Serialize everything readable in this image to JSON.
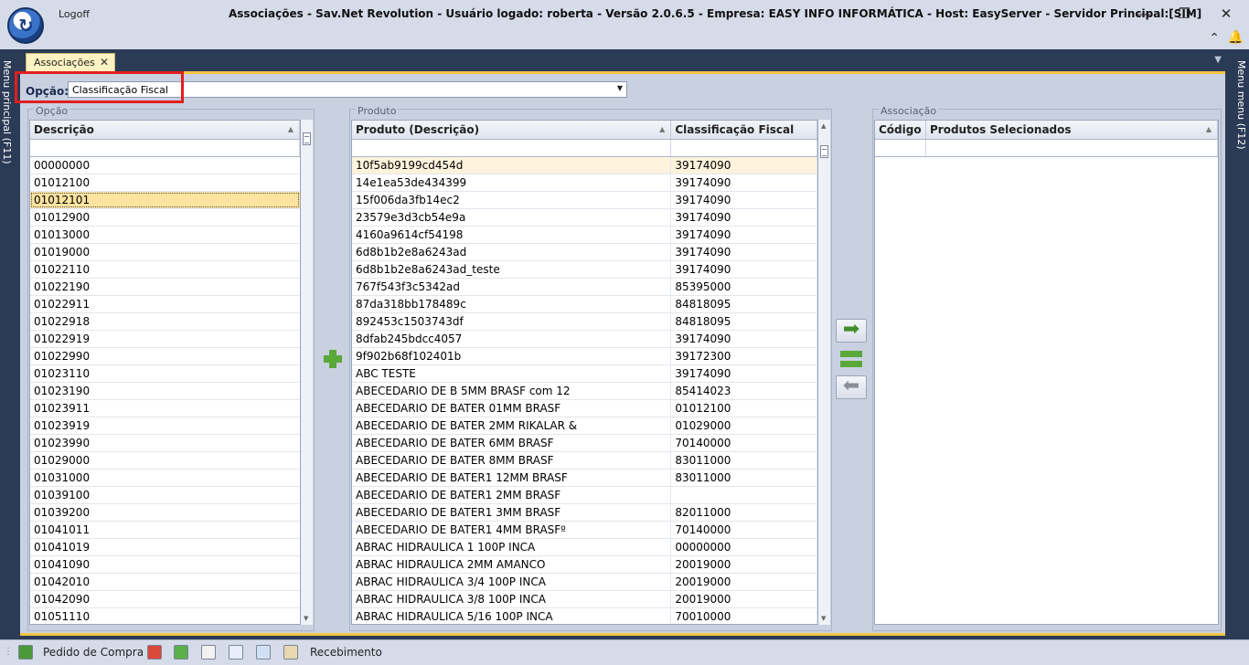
{
  "window": {
    "logoff": "Logoff",
    "title": "Associações - Sav.Net Revolution - Usuário logado: roberta - Versão 2.0.6.5 - Empresa: EASY INFO INFORMÁTICA - Host: EasyServer - Servidor Principal:[SIM]",
    "controls": {
      "minimize": "—",
      "restore": "❐",
      "close": "✕"
    }
  },
  "side_menus": {
    "left": "Menu principal (F11)",
    "right": "Menu menu (F12)"
  },
  "doc_tab": {
    "label": "Associações",
    "close": "✕"
  },
  "option": {
    "label": "Opção:",
    "value": "Classificação Fiscal"
  },
  "groups": {
    "opcao": {
      "title": "Opção",
      "column": "Descrição",
      "rows": [
        "00000000",
        "01012100",
        "01012101",
        "01012900",
        "01013000",
        "01019000",
        "01022110",
        "01022190",
        "01022911",
        "01022918",
        "01022919",
        "01022990",
        "01023110",
        "01023190",
        "01023911",
        "01023919",
        "01023990",
        "01029000",
        "01031000",
        "01039100",
        "01039200",
        "01041011",
        "01041019",
        "01041090",
        "01042010",
        "01042090",
        "01051110"
      ],
      "selected_index": 2
    },
    "produto": {
      "title": "Produto",
      "columns": [
        "Produto (Descrição)",
        "Classificação Fiscal"
      ],
      "rows": [
        [
          "10f5ab9199cd454d",
          "39174090"
        ],
        [
          "14e1ea53de434399",
          "39174090"
        ],
        [
          "15f006da3fb14ec2",
          "39174090"
        ],
        [
          "23579e3d3cb54e9a",
          "39174090"
        ],
        [
          "4160a9614cf54198",
          "39174090"
        ],
        [
          "6d8b1b2e8a6243ad",
          "39174090"
        ],
        [
          "6d8b1b2e8a6243ad_teste",
          "39174090"
        ],
        [
          "767f543f3c5342ad",
          "85395000"
        ],
        [
          "87da318bb178489c",
          "84818095"
        ],
        [
          "892453c1503743df",
          "84818095"
        ],
        [
          "8dfab245bdcc4057",
          "39174090"
        ],
        [
          "9f902b68f102401b",
          "39172300"
        ],
        [
          "ABC TESTE",
          "39174090"
        ],
        [
          "ABECEDARIO DE B 5MM BRASF com 12",
          "85414023"
        ],
        [
          "ABECEDARIO DE BATER 01MM BRASF",
          "01012100"
        ],
        [
          "ABECEDARIO DE BATER 2MM RIKALAR &",
          "01029000"
        ],
        [
          "ABECEDARIO DE BATER 6MM BRASF",
          "70140000"
        ],
        [
          "ABECEDARIO DE BATER 8MM BRASF",
          "83011000"
        ],
        [
          "ABECEDARIO DE BATER1 12MM BRASF",
          "83011000"
        ],
        [
          "ABECEDARIO DE BATER1 2MM BRASF",
          ""
        ],
        [
          "ABECEDARIO DE BATER1 3MM BRASF",
          "82011000"
        ],
        [
          "ABECEDARIO DE BATER1 4MM BRASFº",
          "70140000"
        ],
        [
          "ABRAC HIDRAULICA 1 100P INCA",
          "00000000"
        ],
        [
          "ABRAC HIDRAULICA 2MM AMANCO",
          "20019000"
        ],
        [
          "ABRAC HIDRAULICA 3/4 100P INCA",
          "20019000"
        ],
        [
          "ABRAC HIDRAULICA 3/8 100P INCA",
          "20019000"
        ],
        [
          "ABRAC HIDRAULICA 5/16 100P INCA",
          "70010000"
        ]
      ],
      "hover_index": 0
    },
    "associacao": {
      "title": "Associação",
      "columns": [
        "Código",
        "Produtos Selecionados"
      ]
    }
  },
  "statusbar": {
    "pedido_label": "Pedido de Compra",
    "recebimento_label": "Recebimento"
  }
}
